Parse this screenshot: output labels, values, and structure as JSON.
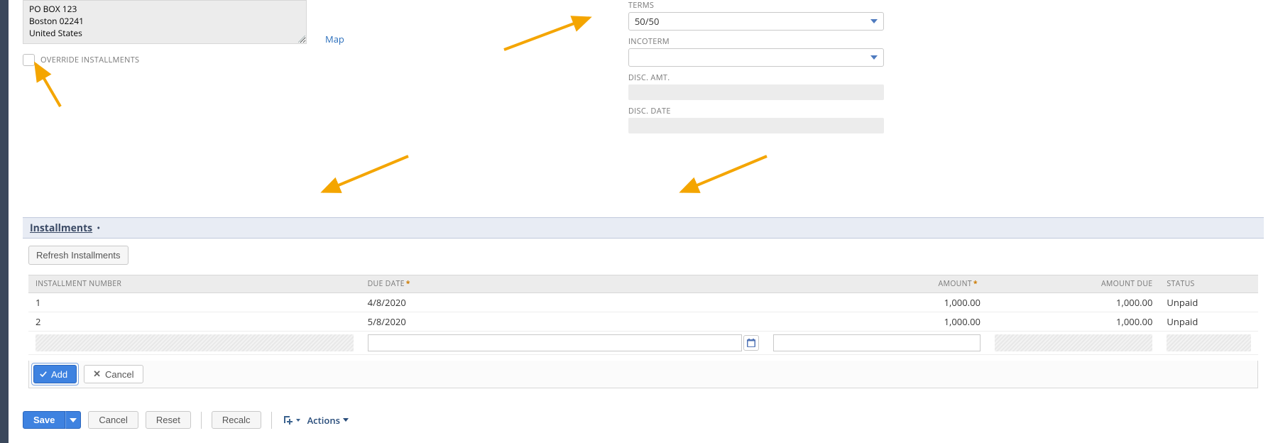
{
  "address": {
    "line1": "PO BOX 123",
    "line2": "Boston  02241",
    "line3": "United States"
  },
  "map_link": "Map",
  "override": {
    "label": "OVERRIDE INSTALLMENTS",
    "checked": false
  },
  "right": {
    "terms": {
      "label": "TERMS",
      "value": "50/50"
    },
    "incoterm": {
      "label": "INCOTERM",
      "value": ""
    },
    "disc_amt": {
      "label": "DISC. AMT."
    },
    "disc_date": {
      "label": "DISC. DATE"
    }
  },
  "subtab": {
    "title": "Installments"
  },
  "refresh_btn": "Refresh Installments",
  "columns": {
    "num": "INSTALLMENT NUMBER",
    "due": "DUE DATE",
    "amount": "AMOUNT",
    "amount_due": "AMOUNT DUE",
    "status": "STATUS"
  },
  "rows": [
    {
      "num": "1",
      "due": "4/8/2020",
      "amount": "1,000.00",
      "amount_due": "1,000.00",
      "status": "Unpaid"
    },
    {
      "num": "2",
      "due": "5/8/2020",
      "amount": "1,000.00",
      "amount_due": "1,000.00",
      "status": "Unpaid"
    }
  ],
  "row_actions": {
    "add": "Add",
    "cancel": "Cancel"
  },
  "footer": {
    "save": "Save",
    "cancel": "Cancel",
    "reset": "Reset",
    "recalc": "Recalc",
    "actions": "Actions"
  }
}
